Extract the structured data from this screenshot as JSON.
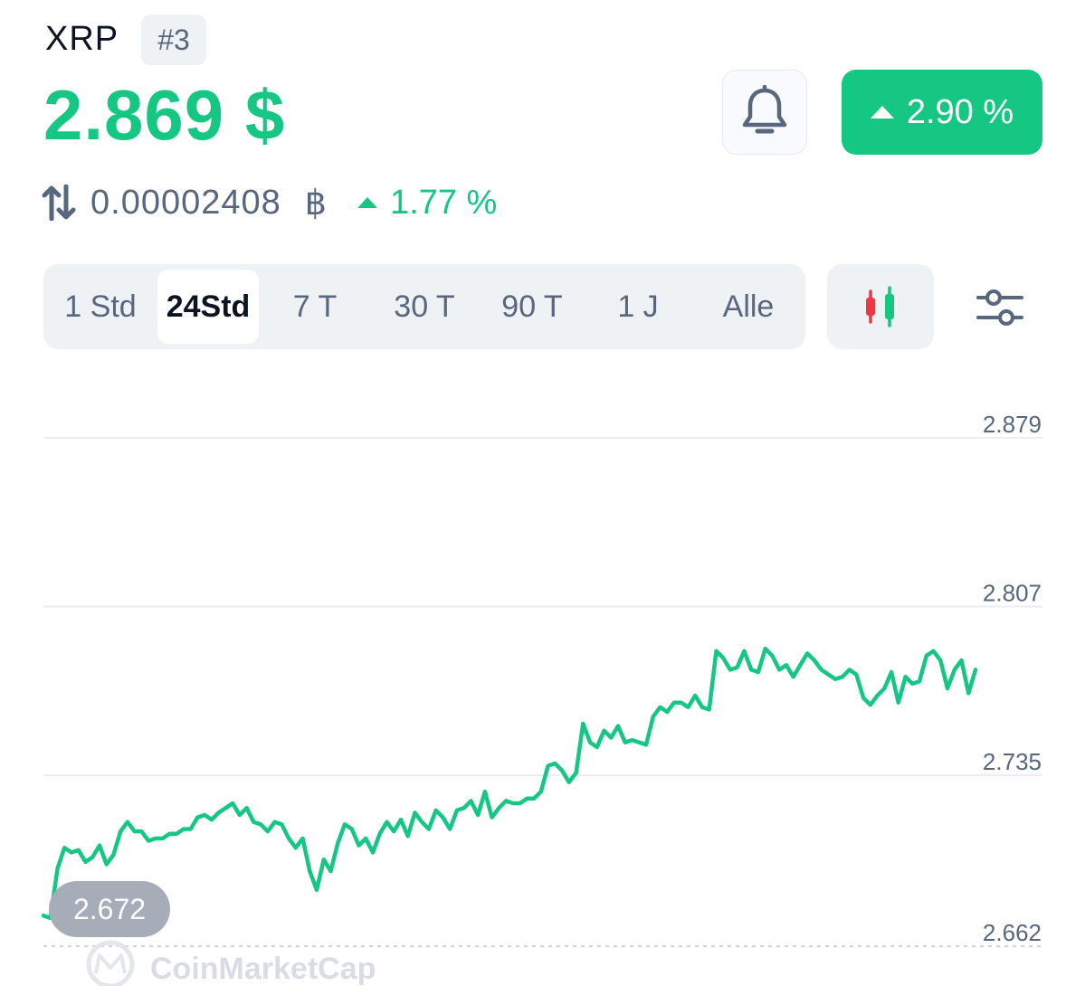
{
  "header": {
    "coin_name": "XRP",
    "rank": "#3",
    "price": "2.869 $",
    "change_24h": "2.90 %",
    "btc_price": "0.00002408",
    "btc_symbol": "฿",
    "btc_change": "1.77 %"
  },
  "time_ranges": [
    {
      "label": "1 Std",
      "active": false
    },
    {
      "label": "24Std",
      "active": true
    },
    {
      "label": "7 T",
      "active": false
    },
    {
      "label": "30 T",
      "active": false
    },
    {
      "label": "90 T",
      "active": false
    },
    {
      "label": "1 J",
      "active": false
    },
    {
      "label": "Alle",
      "active": false
    }
  ],
  "icons": {
    "bell": "bell-icon",
    "candles": "candlestick-icon",
    "settings": "sliders-icon",
    "swap": "swap-arrows-icon"
  },
  "colors": {
    "up": "#16c784",
    "down": "#ea3943",
    "muted": "#58667e",
    "pill_bg": "#eff2f5"
  },
  "watermark": "CoinMarketCap",
  "chart_data": {
    "type": "line",
    "ytick_labels": [
      "2.879",
      "2.807",
      "2.735",
      "2.662"
    ],
    "yticks": [
      2.879,
      2.807,
      2.735,
      2.662
    ],
    "ylim": [
      2.662,
      2.879
    ],
    "low_label": "2.672",
    "low_value": 2.672,
    "grid": true,
    "series": [
      {
        "values": [
          2.675,
          2.674,
          2.695,
          2.704,
          2.702,
          2.703,
          2.698,
          2.7,
          2.705,
          2.697,
          2.701,
          2.711,
          2.715,
          2.711,
          2.711,
          2.707,
          2.708,
          2.708,
          2.71,
          2.71,
          2.712,
          2.712,
          2.717,
          2.718,
          2.716,
          2.719,
          2.721,
          2.723,
          2.718,
          2.721,
          2.715,
          2.714,
          2.711,
          2.715,
          2.714,
          2.708,
          2.704,
          2.708,
          2.694,
          2.686,
          2.699,
          2.694,
          2.706,
          2.714,
          2.712,
          2.705,
          2.708,
          2.702,
          2.71,
          2.715,
          2.711,
          2.716,
          2.709,
          2.719,
          2.715,
          2.712,
          2.72,
          2.717,
          2.712,
          2.72,
          2.721,
          2.724,
          2.718,
          2.728,
          2.717,
          2.721,
          2.724,
          2.723,
          2.723,
          2.725,
          2.725,
          2.728,
          2.739,
          2.74,
          2.737,
          2.732,
          2.736,
          2.757,
          2.749,
          2.747,
          2.754,
          2.751,
          2.756,
          2.749,
          2.75,
          2.749,
          2.748,
          2.76,
          2.764,
          2.762,
          2.766,
          2.766,
          2.764,
          2.769,
          2.764,
          2.763,
          2.788,
          2.785,
          2.78,
          2.781,
          2.788,
          2.78,
          2.779,
          2.789,
          2.786,
          2.78,
          2.782,
          2.777,
          2.782,
          2.787,
          2.784,
          2.78,
          2.778,
          2.776,
          2.777,
          2.78,
          2.778,
          2.768,
          2.765,
          2.769,
          2.772,
          2.779,
          2.766,
          2.777,
          2.774,
          2.775,
          2.786,
          2.788,
          2.784,
          2.772,
          2.78,
          2.784,
          2.77,
          2.78
        ]
      }
    ]
  }
}
